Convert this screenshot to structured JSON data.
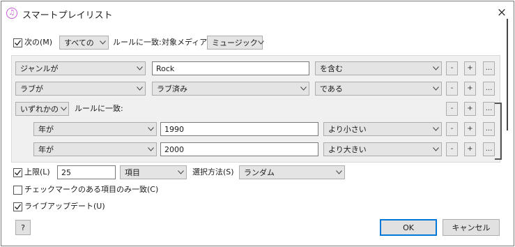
{
  "window": {
    "title": "スマートプレイリスト",
    "close": "×",
    "icon": "music-note-icon"
  },
  "match": {
    "checked": true,
    "label": "次の(M)",
    "scope": "すべての",
    "rule_label": "ルールに一致:",
    "media_label": "対象メディア:",
    "media_value": "ミュージック"
  },
  "rules": [
    {
      "field": "ジャンルが",
      "value": "Rock",
      "op": "を含む",
      "value_type": "input"
    },
    {
      "field": "ラブが",
      "value": "ラブ済み",
      "op": "である",
      "value_type": "select"
    }
  ],
  "nested": {
    "scope": "いずれかの",
    "rule_label": "ルールに一致:",
    "rules": [
      {
        "field": "年が",
        "value": "1990",
        "op": "より小さい"
      },
      {
        "field": "年が",
        "value": "2000",
        "op": "より大きい"
      }
    ]
  },
  "rule_buttons": {
    "minus": "-",
    "plus": "+",
    "more": "..."
  },
  "limit": {
    "checked": true,
    "label": "上限(L)",
    "value": "25",
    "unit": "項目",
    "method_label": "選択方法(S)",
    "method_value": "ランダム"
  },
  "checked_only": {
    "checked": false,
    "label": "チェックマークのある項目のみ一致(C)"
  },
  "live_update": {
    "checked": true,
    "label": "ライブアップデート(U)"
  },
  "buttons": {
    "help": "?",
    "ok": "OK",
    "cancel": "キャンセル"
  },
  "colors": {
    "accent": "#0078d7",
    "panel": "#f0f0f0",
    "dropdown": "#e4e4e4"
  }
}
